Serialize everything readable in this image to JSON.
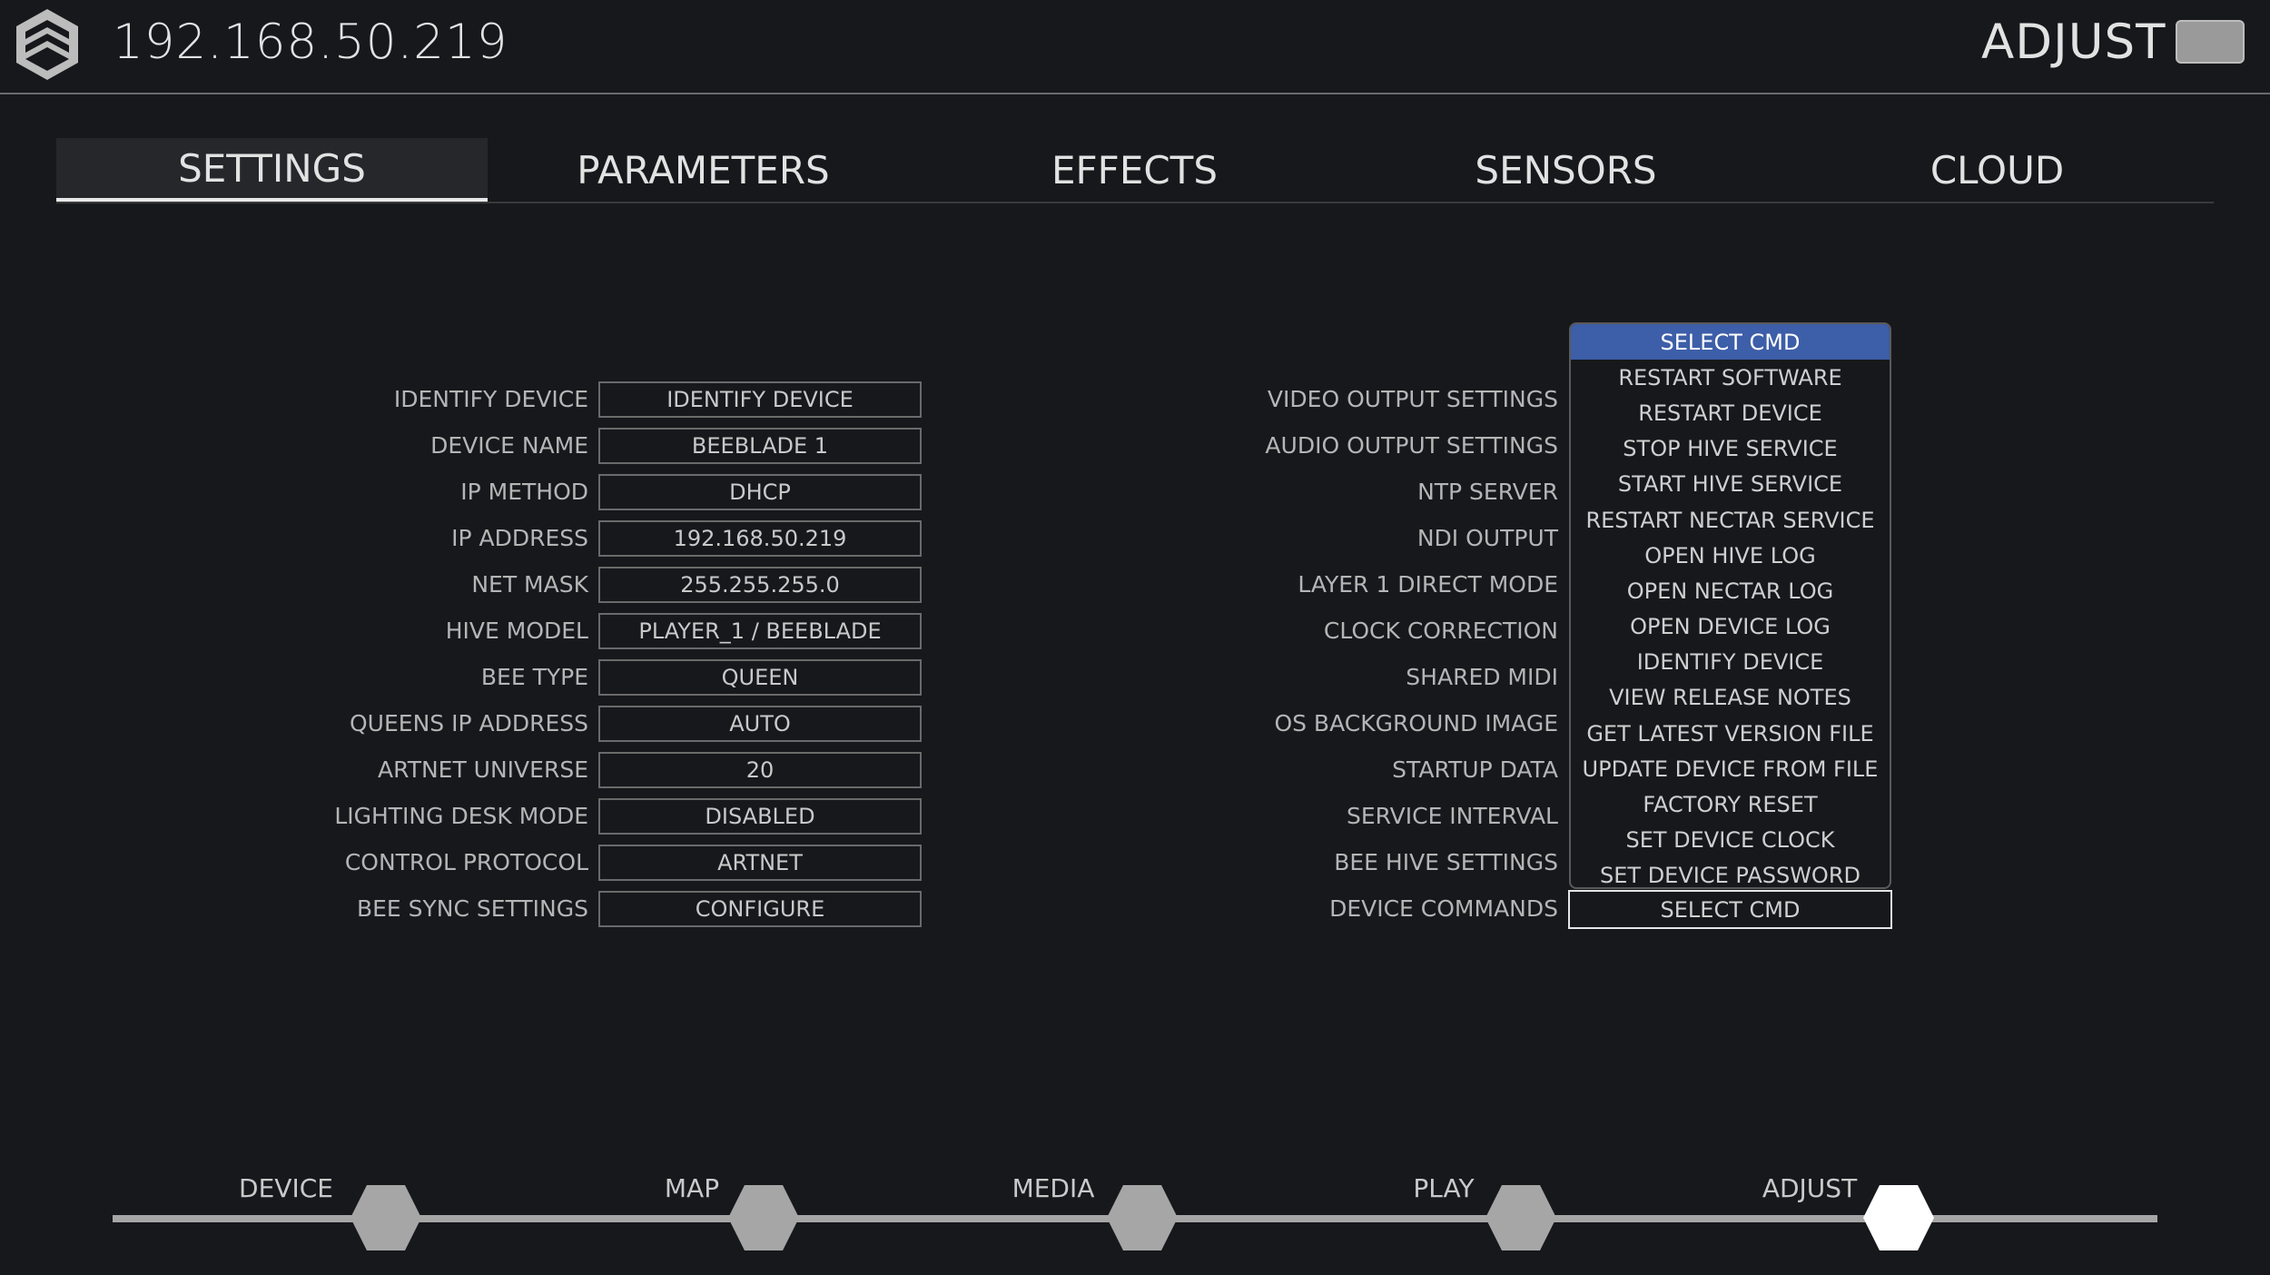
{
  "header": {
    "ip": "192.168.50.219",
    "mode": "ADJUST",
    "logo_icon": "hive-logo-icon",
    "toggle_color": "#9a9a9a"
  },
  "tabs": [
    "SETTINGS",
    "PARAMETERS",
    "EFFECTS",
    "SENSORS",
    "CLOUD"
  ],
  "active_tab": "SETTINGS",
  "left_settings": [
    {
      "label": "IDENTIFY DEVICE",
      "value": "IDENTIFY DEVICE"
    },
    {
      "label": "DEVICE NAME",
      "value": "BEEBLADE 1"
    },
    {
      "label": "IP METHOD",
      "value": "DHCP"
    },
    {
      "label": "IP ADDRESS",
      "value": "192.168.50.219"
    },
    {
      "label": "NET MASK",
      "value": "255.255.255.0"
    },
    {
      "label": "HIVE MODEL",
      "value": "PLAYER_1 / BEEBLADE"
    },
    {
      "label": "BEE TYPE",
      "value": "QUEEN"
    },
    {
      "label": "QUEENS IP ADDRESS",
      "value": "AUTO"
    },
    {
      "label": "ARTNET UNIVERSE",
      "value": "20"
    },
    {
      "label": "LIGHTING DESK MODE",
      "value": "DISABLED"
    },
    {
      "label": "CONTROL PROTOCOL",
      "value": "ARTNET"
    },
    {
      "label": "BEE SYNC SETTINGS",
      "value": "CONFIGURE"
    }
  ],
  "right_settings": [
    {
      "label": "VIDEO OUTPUT SETTINGS"
    },
    {
      "label": "AUDIO OUTPUT SETTINGS"
    },
    {
      "label": "NTP SERVER"
    },
    {
      "label": "NDI OUTPUT"
    },
    {
      "label": "LAYER 1 DIRECT MODE"
    },
    {
      "label": "CLOCK CORRECTION"
    },
    {
      "label": "SHARED MIDI"
    },
    {
      "label": "OS BACKGROUND IMAGE"
    },
    {
      "label": "STARTUP DATA"
    },
    {
      "label": "SERVICE INTERVAL"
    },
    {
      "label": "BEE HIVE SETTINGS"
    },
    {
      "label": "DEVICE COMMANDS",
      "value": "SELECT CMD"
    }
  ],
  "device_commands_dropdown": {
    "selected": "SELECT CMD",
    "options": [
      "SELECT CMD",
      "RESTART SOFTWARE",
      "RESTART DEVICE",
      "STOP HIVE SERVICE",
      "START HIVE SERVICE",
      "RESTART NECTAR SERVICE",
      "OPEN HIVE LOG",
      "OPEN NECTAR LOG",
      "OPEN DEVICE LOG",
      "IDENTIFY DEVICE",
      "VIEW RELEASE NOTES",
      "GET LATEST VERSION FILE",
      "UPDATE DEVICE FROM FILE",
      "FACTORY RESET",
      "SET DEVICE CLOCK",
      "SET DEVICE PASSWORD"
    ],
    "highlight_color": "#3d5ea8"
  },
  "timeline": {
    "stages": [
      "DEVICE",
      "MAP",
      "MEDIA",
      "PLAY",
      "ADJUST"
    ],
    "active": "ADJUST",
    "inactive_color": "#a6a6a6",
    "active_color": "#ffffff"
  }
}
